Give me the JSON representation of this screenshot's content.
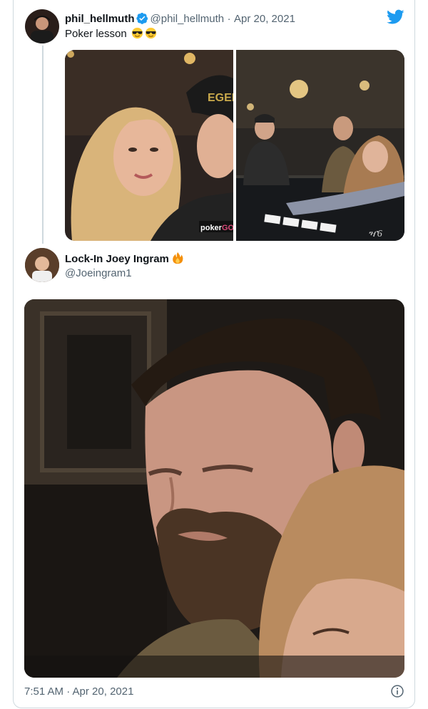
{
  "quoted_tweet": {
    "display_name": "phil_hellmuth",
    "handle": "@phil_hellmuth",
    "separator": "·",
    "date": "Apr 20, 2021",
    "text": "Poker lesson",
    "emojis": [
      "sunglasses-emoji",
      "sunglasses-emoji"
    ],
    "verified": true,
    "photos": [
      {
        "description_icon": "selfie-photo"
      },
      {
        "description_icon": "poker-table-photo"
      }
    ]
  },
  "reply_tweet": {
    "display_name": "Lock-In Joey Ingram",
    "name_emoji": "fire-emoji",
    "handle": "@Joeingram1",
    "photo_icon": "closeup-photo",
    "timestamp": "7:51 AM · Apr 20, 2021"
  },
  "icons": {
    "brand": "twitter-bird-icon",
    "info": "info-icon"
  },
  "colors": {
    "brand": "#1d9bf0",
    "muted": "#536471",
    "border": "#cfd9de"
  }
}
